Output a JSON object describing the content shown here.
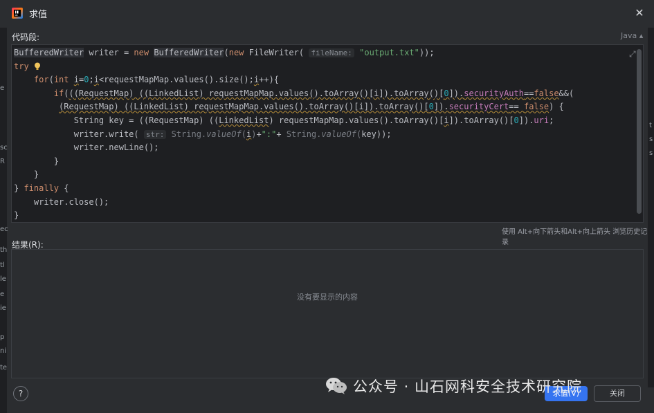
{
  "dialog": {
    "title": "求值",
    "code_fragment_label": "代码段:",
    "language": "Java",
    "history_hint": "使用 Alt+向下箭头和Alt+向上箭头 浏览历史记录",
    "result_label": "结果(R):",
    "result_empty": "没有要显示的内容",
    "evaluate_button": "求值(V)",
    "close_button": "关闭",
    "help_label": "?"
  },
  "code_lines": [
    "BufferedWriter writer = new BufferedWriter(new FileWriter( fileName: \"output.txt\"));",
    "try",
    "    for(int i=0;i<requestMapMap.values().size();i++){",
    "        if(((RequestMap) ((LinkedList) requestMapMap.values().toArray()[i]).toArray()[0]).securityAuth==false&&(",
    "         (RequestMap) ((LinkedList) requestMapMap.values().toArray()[i]).toArray()[0]).securityCert== false) {",
    "            String key = ((RequestMap) ((LinkedList) requestMapMap.values().toArray()[i]).toArray()[0]).uri;",
    "            writer.write( str: String.valueOf(i)+\":\"+ String.valueOf(key));",
    "            writer.newLine();",
    "        }",
    "    }",
    "} finally {",
    "    writer.close();",
    "}"
  ],
  "watermark": {
    "text": "公众号 · 山石网科安全技术研究院"
  },
  "edge_left_text": [
    "e",
    "sc",
    "R",
    "ec",
    "th",
    "tl",
    "le",
    "e",
    "ie",
    "p",
    "ni",
    "te"
  ],
  "edge_right_text": [
    "t",
    "s",
    "s"
  ],
  "colors": {
    "accent": "#3574f0",
    "keyword": "#cf8e6d",
    "number": "#2aacb8",
    "string": "#6aab73",
    "field": "#c77dbb"
  },
  "icons": [
    "intellij-app-icon",
    "close-icon",
    "expand-icon",
    "bulb-icon",
    "help-icon",
    "wechat-logo-icon"
  ]
}
